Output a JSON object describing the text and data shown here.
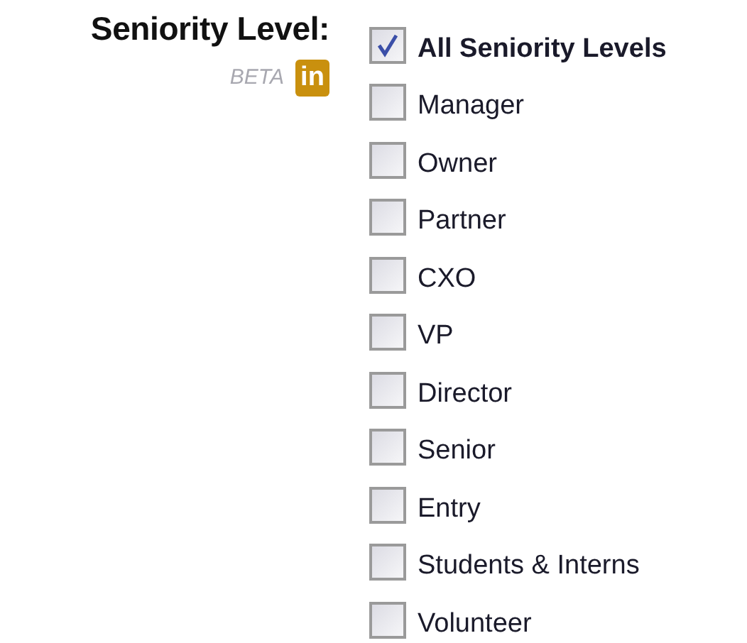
{
  "filter": {
    "label": "Seniority Level:",
    "beta": "BETA",
    "badge": "in",
    "options": [
      {
        "label": "All Seniority Levels",
        "checked": true
      },
      {
        "label": "Manager",
        "checked": false
      },
      {
        "label": "Owner",
        "checked": false
      },
      {
        "label": "Partner",
        "checked": false
      },
      {
        "label": "CXO",
        "checked": false
      },
      {
        "label": "VP",
        "checked": false
      },
      {
        "label": "Director",
        "checked": false
      },
      {
        "label": "Senior",
        "checked": false
      },
      {
        "label": "Entry",
        "checked": false
      },
      {
        "label": "Students & Interns",
        "checked": false
      },
      {
        "label": "Volunteer",
        "checked": false
      }
    ]
  }
}
